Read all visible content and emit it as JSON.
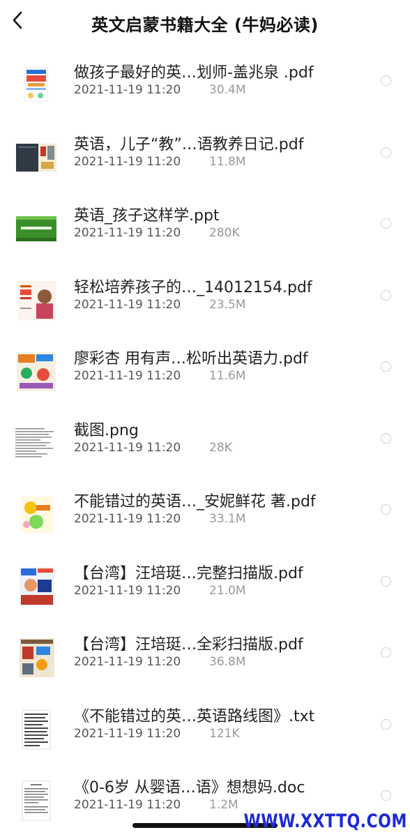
{
  "header": {
    "title": "英文启蒙书籍大全 (牛妈必读)"
  },
  "files": [
    {
      "name": "做孩子最好的英…划师-盖兆泉 .pdf",
      "date": "2021-11-19 11:20",
      "size": "30.4M",
      "thumb": "book-cover-1"
    },
    {
      "name": "英语，儿子“教”…语教养日记.pdf",
      "date": "2021-11-19 11:20",
      "size": "11.8M",
      "thumb": "book-cover-2"
    },
    {
      "name": "英语_孩子这样学.ppt",
      "date": "2021-11-19 11:20",
      "size": "280K",
      "thumb": "slide-thumbnail"
    },
    {
      "name": "轻松培养孩子的…_14012154.pdf",
      "date": "2021-11-19 11:20",
      "size": "23.5M",
      "thumb": "book-cover-3"
    },
    {
      "name": "廖彩杏  用有声…松听出英语力.pdf",
      "date": "2021-11-19 11:20",
      "size": "11.6M",
      "thumb": "book-cover-4"
    },
    {
      "name": "截图.png",
      "date": "2021-11-19 11:20",
      "size": "28K",
      "thumb": "text-screenshot"
    },
    {
      "name": "不能错过的英语…_安妮鲜花 著.pdf",
      "date": "2021-11-19 11:20",
      "size": "33.1M",
      "thumb": "book-cover-5"
    },
    {
      "name": "【台湾】汪培珽…完整扫描版.pdf",
      "date": "2021-11-19 11:20",
      "size": "21.0M",
      "thumb": "book-cover-6"
    },
    {
      "name": "【台湾】汪培珽…全彩扫描版.pdf",
      "date": "2021-11-19 11:20",
      "size": "36.8M",
      "thumb": "book-cover-7"
    },
    {
      "name": "《不能错过的英…英语路线图》.txt",
      "date": "2021-11-19 11:20",
      "size": "121K",
      "thumb": "text-document"
    },
    {
      "name": "《0-6岁 从婴语…语》想想妈.doc",
      "date": "2021-11-19 11:20",
      "size": "1.2M",
      "thumb": "word-document"
    }
  ],
  "watermark": "WWW.XXTTQ.COM",
  "colors": {
    "watermark": "#1e2ad6",
    "radio_border": "#cfcfcf"
  }
}
